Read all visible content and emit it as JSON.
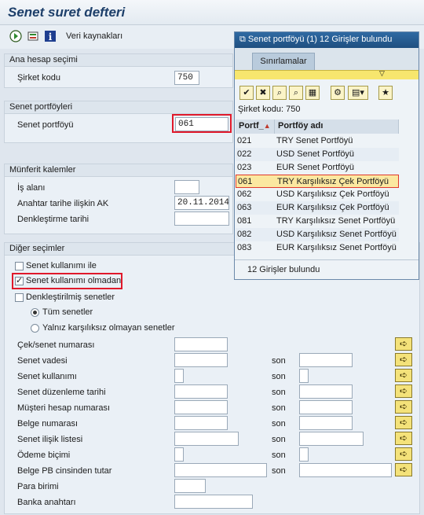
{
  "window": {
    "title": "Senet suret defteri"
  },
  "toolbar": {
    "data_sources_label": "Veri kaynakları"
  },
  "sections": {
    "main_account": {
      "title": "Ana hesap seçimi",
      "company_label": "Şirket kodu",
      "company_value": "750"
    },
    "note_portfolios": {
      "title": "Senet portföyleri",
      "portfolio_label": "Senet portföyü",
      "portfolio_value": "061"
    },
    "individual_items": {
      "title": "Münferit kalemler",
      "business_area_label": "İş alanı",
      "business_area_value": "",
      "key_date_label": "Anahtar tarihe ilişkin AK",
      "key_date_value": "20.11.2014",
      "clearing_date_label": "Denkleştirme tarihi",
      "clearing_date_value": ""
    },
    "other_selections": {
      "title": "Diğer seçimler",
      "chk_with_usage": {
        "label": "Senet kullanımı ile",
        "checked": false
      },
      "chk_without_usage": {
        "label": "Senet kullanımı olmadan",
        "checked": true
      },
      "chk_cleared": {
        "label": "Denkleştirilmiş senetler",
        "checked": false
      },
      "radio_all": {
        "label": "Tüm senetler",
        "selected": true
      },
      "radio_nonrecourse": {
        "label": "Yalnız karşılıksız olmayan senetler",
        "selected": false
      },
      "range_to_label": "son",
      "rows": [
        "Çek/senet numarası",
        "Senet vadesi",
        "Senet kullanımı",
        "Senet düzenleme tarihi",
        "Müşteri hesap numarası",
        "Belge numarası",
        "Senet ilişik listesi",
        "Ödeme biçimi",
        "Belge PB cinsinden tutar",
        "Para birimi",
        "Banka anahtarı"
      ]
    }
  },
  "popup": {
    "title": "Senet portföyü (1)   12 Girişler bulundu",
    "tab_label": "Sınırlamalar",
    "company_line": "Şirket kodu: 750",
    "col_key": "Portf_",
    "col_name": "Portföy adı",
    "rows": [
      {
        "key": "021",
        "name": "TRY Senet Portföyü"
      },
      {
        "key": "022",
        "name": "USD Senet Portföyü"
      },
      {
        "key": "023",
        "name": "EUR Senet Portföyü"
      },
      {
        "key": "061",
        "name": "TRY Karşılıksız Çek Portföyü"
      },
      {
        "key": "062",
        "name": "USD Karşılıksız Çek Portföyü"
      },
      {
        "key": "063",
        "name": "EUR Karşılıksız Çek Portföyü"
      },
      {
        "key": "081",
        "name": "TRY Karşılıksız Senet Portföyü"
      },
      {
        "key": "082",
        "name": "USD Karşılıksız Senet Portföyü"
      },
      {
        "key": "083",
        "name": "EUR Karşılıksız Senet Portföyü"
      }
    ],
    "footer": "12 Girişler bulundu"
  }
}
